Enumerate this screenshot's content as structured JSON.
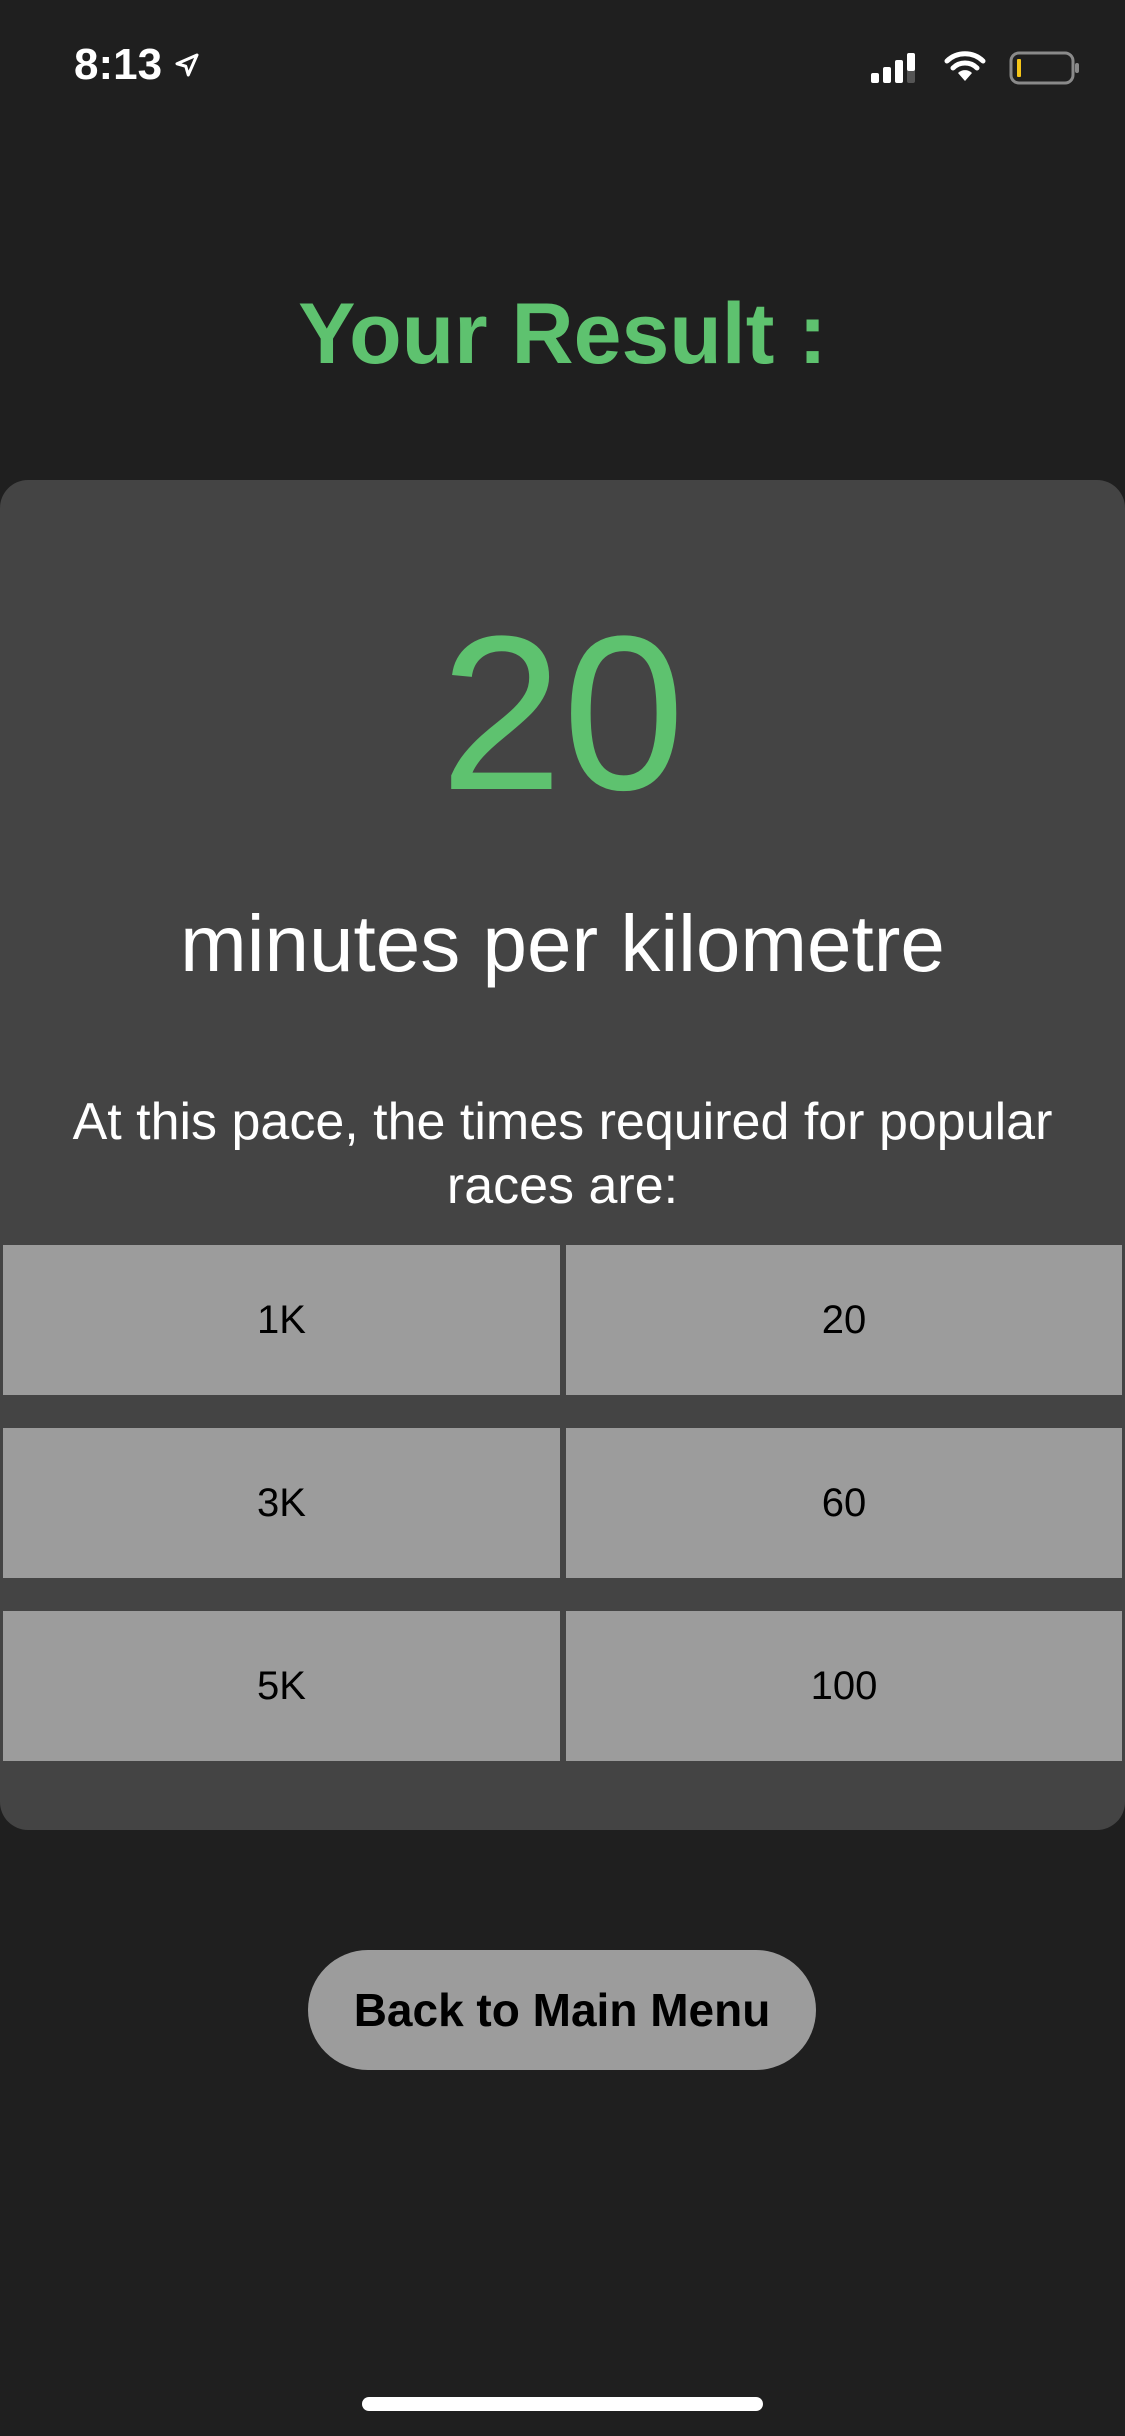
{
  "status_bar": {
    "time": "8:13",
    "icons": [
      "location-arrow-icon",
      "cellular-signal-icon",
      "wifi-icon",
      "battery-icon"
    ]
  },
  "title": "Your Result :",
  "result": {
    "pace_value": "20",
    "pace_unit": "minutes per kilometre",
    "races_intro": "At this pace, the times required for popular races are:",
    "races": [
      {
        "distance": "1K",
        "time": "20"
      },
      {
        "distance": "3K",
        "time": "60"
      },
      {
        "distance": "5K",
        "time": "100"
      }
    ]
  },
  "back_button_label": "Back to Main Menu",
  "colors": {
    "background": "#1f1f1f",
    "card": "#444444",
    "accent": "#5ec26f",
    "cell": "#9c9c9c",
    "battery_low": "#f5c518"
  }
}
